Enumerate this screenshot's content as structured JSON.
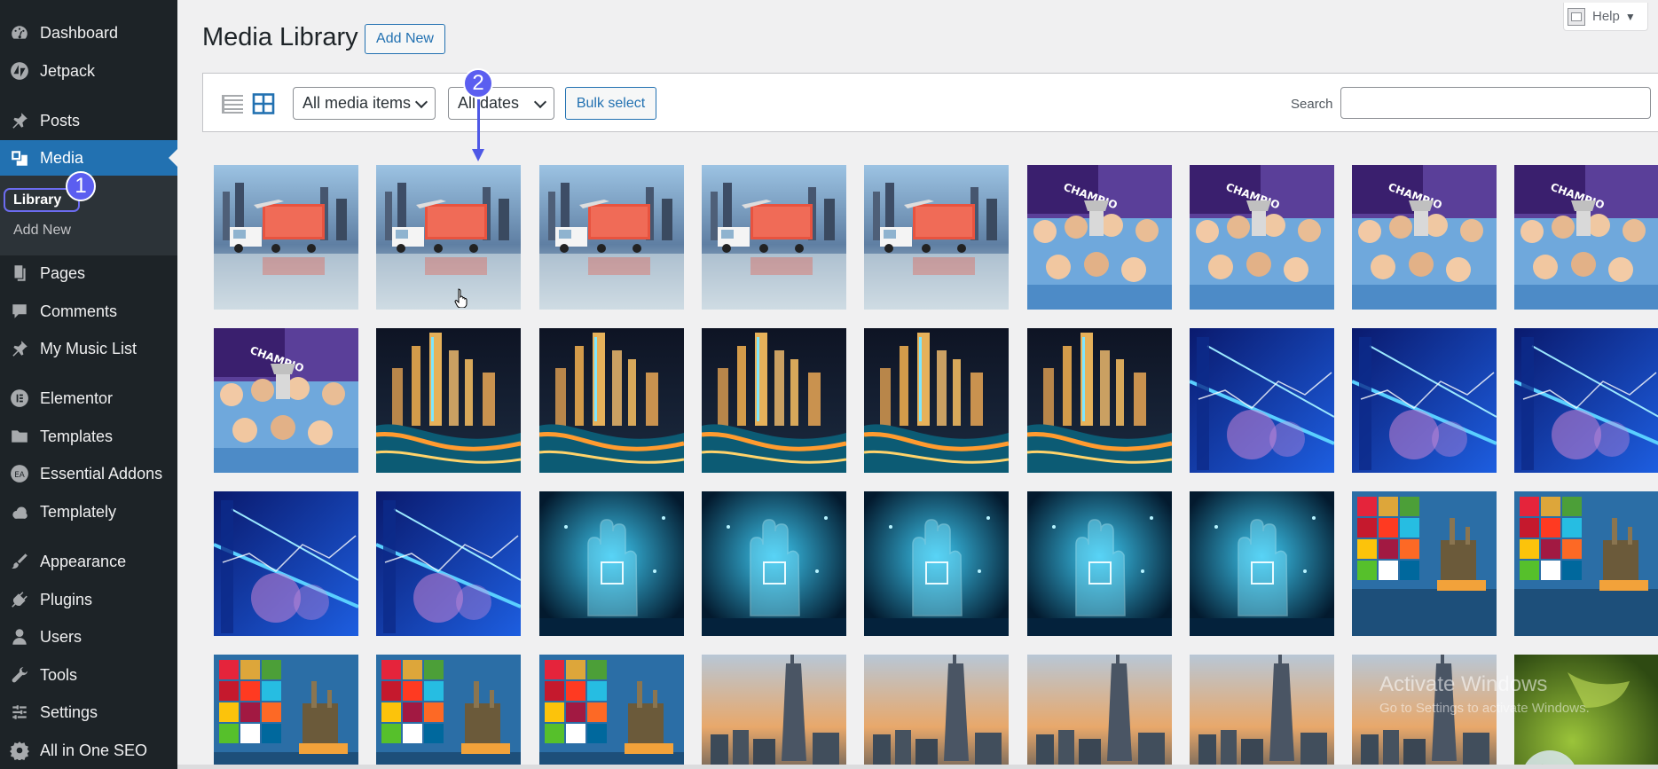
{
  "sidebar": {
    "items": [
      {
        "label": "Dashboard",
        "icon": "dashboard-icon"
      },
      {
        "label": "Jetpack",
        "icon": "jetpack-icon"
      },
      {
        "label": "Posts",
        "icon": "pin-icon"
      },
      {
        "label": "Media",
        "icon": "media-icon"
      },
      {
        "label": "Pages",
        "icon": "pages-icon"
      },
      {
        "label": "Comments",
        "icon": "comment-icon"
      },
      {
        "label": "My Music List",
        "icon": "pin-icon"
      },
      {
        "label": "Elementor",
        "icon": "elementor-icon"
      },
      {
        "label": "Templates",
        "icon": "folder-icon"
      },
      {
        "label": "Essential Addons",
        "icon": "ea-icon"
      },
      {
        "label": "Templately",
        "icon": "cloud-icon"
      },
      {
        "label": "Appearance",
        "icon": "brush-icon"
      },
      {
        "label": "Plugins",
        "icon": "plug-icon"
      },
      {
        "label": "Users",
        "icon": "user-icon"
      },
      {
        "label": "Tools",
        "icon": "wrench-icon"
      },
      {
        "label": "Settings",
        "icon": "settings-icon"
      },
      {
        "label": "All in One SEO",
        "icon": "seo-icon"
      }
    ],
    "submenu": [
      {
        "label": "Library"
      },
      {
        "label": "Add New"
      }
    ]
  },
  "annotations": {
    "step1": "1",
    "step2": "2"
  },
  "header": {
    "title": "Media Library",
    "add_new": "Add New",
    "help": "Help"
  },
  "toolbar": {
    "media_filter": "All media items",
    "date_filter": "All dates",
    "bulk_select": "Bulk select",
    "search_label": "Search",
    "search_value": ""
  },
  "watermark": {
    "title": "Activate Windows",
    "subtitle": "Go to Settings to activate Windows."
  },
  "colors": {
    "sidebar": "#1d2327",
    "accent": "#2271b1",
    "submenu": "#2c3338",
    "annotation": "#5b5ef0"
  },
  "media_grid": [
    [
      "logistics",
      "logistics",
      "logistics",
      "logistics",
      "logistics",
      "football",
      "football",
      "football",
      "football"
    ],
    [
      "football",
      "dubai-night",
      "dubai-night",
      "dubai-night",
      "dubai-night",
      "dubai-night",
      "finance",
      "finance",
      "finance"
    ],
    [
      "finance",
      "finance",
      "tech-hand",
      "tech-hand",
      "tech-hand",
      "tech-hand",
      "tech-hand",
      "sdg-oil",
      "sdg-oil"
    ],
    [
      "sdg-oil",
      "sdg-oil",
      "sdg-oil",
      "dubai-dusk",
      "dubai-dusk",
      "dubai-dusk",
      "dubai-dusk",
      "dubai-dusk",
      "earth-green"
    ]
  ]
}
